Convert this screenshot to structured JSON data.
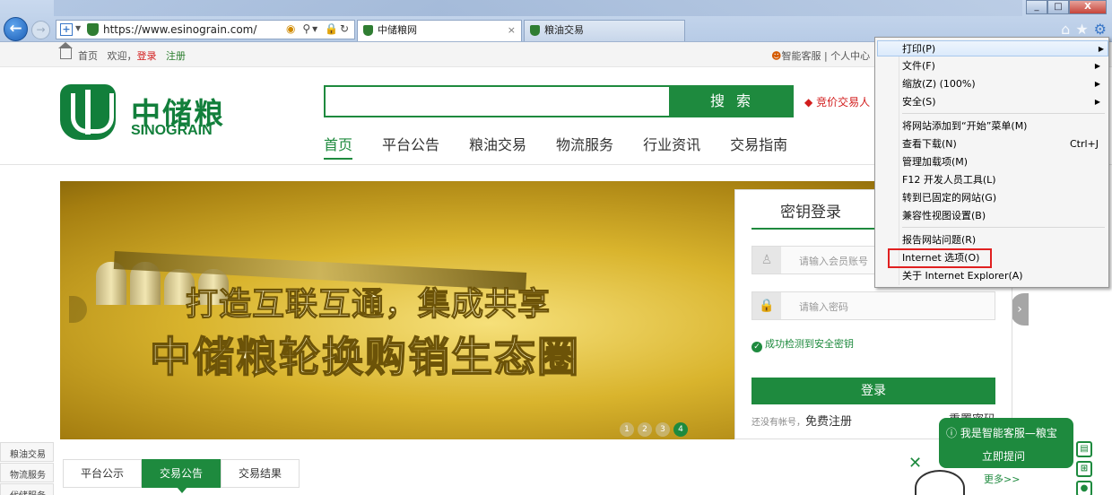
{
  "browser": {
    "url": "https://www.esinograin.com/",
    "tabs": [
      {
        "label": "中储粮网",
        "active": true,
        "close": "×"
      },
      {
        "label": "粮油交易",
        "active": false
      }
    ],
    "window_buttons": [
      "_",
      "□",
      "X"
    ]
  },
  "topbar": {
    "home": "首页",
    "welcome": "欢迎，",
    "login": "登录",
    "register": "注册",
    "service": "智能客服",
    "sep": "|",
    "user_center": "个人中心"
  },
  "header": {
    "logo_cn": "中储粮",
    "logo_en": "SINOGRAIN",
    "search_button": "搜 索",
    "bid_link": "竞价交易人",
    "nav": [
      "首页",
      "平台公告",
      "粮油交易",
      "物流服务",
      "行业资讯",
      "交易指南"
    ]
  },
  "banner": {
    "line1": "打造互联互通，集成共享",
    "line2": "中储粮轮换购销生态圈",
    "dots": [
      "1",
      "2",
      "3",
      "4"
    ],
    "active_dot": 4
  },
  "login": {
    "title": "密钥登录",
    "account_placeholder": "请输入会员账号",
    "password_placeholder": "请输入密码",
    "key_status": "成功检测到安全密钥",
    "button": "登录",
    "no_account": "还没有帐号，",
    "free_register": "免费注册",
    "reset_password": "重置密码"
  },
  "side_menu": [
    "粮油交易",
    "物流服务",
    "代储服务"
  ],
  "announce_tabs": [
    {
      "label": "平台公示",
      "active": false
    },
    {
      "label": "交易公告",
      "active": true
    },
    {
      "label": "交易结果",
      "active": false
    }
  ],
  "service_widget": {
    "line1": "我是智能客服—粮宝",
    "line2": "立即提问",
    "more": "更多>>"
  },
  "tools_menu": {
    "items": [
      {
        "label": "打印(P)",
        "submenu": true
      },
      {
        "label": "文件(F)",
        "submenu": true
      },
      {
        "label": "缩放(Z) (100%)",
        "submenu": true
      },
      {
        "label": "安全(S)",
        "submenu": true
      },
      {
        "label": "将网站添加到“开始”菜单(M)"
      },
      {
        "label": "查看下载(N)",
        "shortcut": "Ctrl+J"
      },
      {
        "label": "管理加载项(M)"
      },
      {
        "label": "F12 开发人员工具(L)"
      },
      {
        "label": "转到已固定的网站(G)"
      },
      {
        "label": "兼容性视图设置(B)"
      },
      {
        "label": "报告网站问题(R)"
      },
      {
        "label": "Internet 选项(O)"
      },
      {
        "label": "关于 Internet Explorer(A)"
      }
    ],
    "highlighted_item": "打印(P)",
    "boxed_item": "Internet 选项(O)"
  },
  "colors": {
    "brand_green": "#1e8a3e",
    "accent_red": "#d21d1d",
    "highlight_box": "#e02020"
  }
}
